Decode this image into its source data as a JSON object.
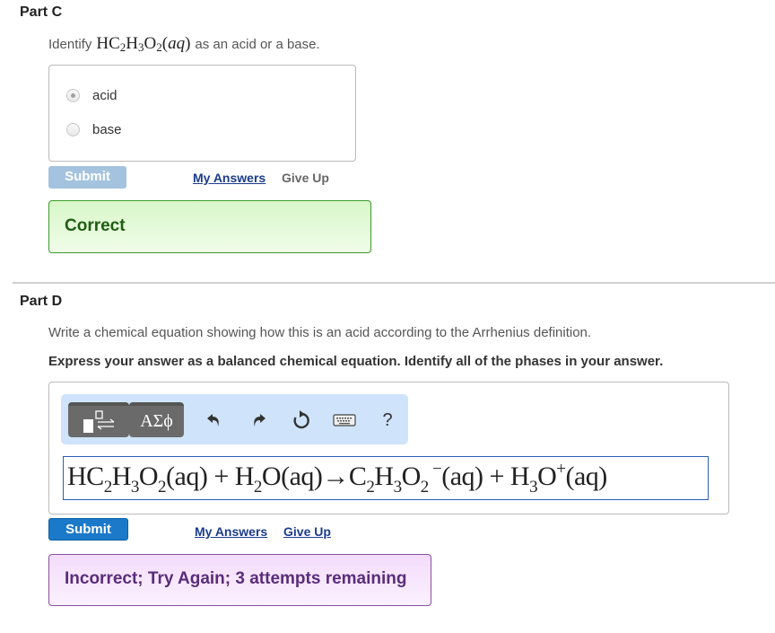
{
  "partC": {
    "title": "Part C",
    "prompt_before": "Identify",
    "formula": {
      "parts": [
        "HC",
        "2",
        "H",
        "3",
        "O",
        "2",
        "(",
        "aq",
        ")"
      ]
    },
    "prompt_after": "as an acid or a base.",
    "choices": [
      {
        "label": "acid",
        "selected": true
      },
      {
        "label": "base",
        "selected": false
      }
    ],
    "submit_label": "Submit",
    "my_answers_label": "My Answers",
    "give_up_label": "Give Up",
    "feedback": "Correct",
    "feedback_color": "#1f5d12"
  },
  "partD": {
    "title": "Part D",
    "prompt": "Write a chemical equation showing how this is an acid according to the Arrhenius definition.",
    "instruction": "Express your answer as a balanced chemical equation. Identify all of the phases in your answer.",
    "toolbar": {
      "template_icon": "template-arrows-icon",
      "greek_label": "ΑΣϕ",
      "undo_icon": "undo-icon",
      "redo_icon": "redo-icon",
      "reset_icon": "reset-icon",
      "keyboard_icon": "keyboard-icon",
      "help_label": "?"
    },
    "answer": {
      "tokens": [
        {
          "t": "HC"
        },
        {
          "sub": "2"
        },
        {
          "t": "H"
        },
        {
          "sub": "3"
        },
        {
          "t": "O"
        },
        {
          "sub": "2"
        },
        {
          "t": "(aq) + H"
        },
        {
          "sub": "2"
        },
        {
          "t": "O(aq)→C"
        },
        {
          "sub": "2"
        },
        {
          "t": "H"
        },
        {
          "sub": "3"
        },
        {
          "t": "O"
        },
        {
          "sub": "2"
        },
        {
          "sup": " −"
        },
        {
          "t": "(aq) + H"
        },
        {
          "sub": "3"
        },
        {
          "t": "O"
        },
        {
          "sup": "+"
        },
        {
          "t": "(aq)"
        }
      ]
    },
    "submit_label": "Submit",
    "my_answers_label": "My Answers",
    "give_up_label": "Give Up",
    "feedback": "Incorrect; Try Again; 3 attempts remaining",
    "feedback_color": "#5a2d7a"
  }
}
